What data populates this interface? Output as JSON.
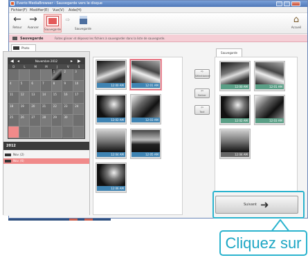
{
  "window": {
    "title": "Everio MediaBrowser - Sauvegarde vers le disque"
  },
  "menubar": [
    "Fichier(F)",
    "Modifier(E)",
    "Vue(V)",
    "Aide(H)"
  ],
  "toolbar": {
    "back_label": "Retour",
    "forward_label": "Avancer",
    "card_label": "Sauvegarde",
    "disk_label": "Sauvegarde",
    "home_label": "Accueil"
  },
  "strip": {
    "title": "Sauvegarde",
    "text": "Faites glisser et déposez les fichiers à sauvegarder dans la liste de sauvegarde."
  },
  "left_panel": {
    "tab_label": "Photo",
    "calendar": {
      "month": "Novembre 2012",
      "weekdays": [
        "D",
        "L",
        "M",
        "M",
        "J",
        "V",
        "S"
      ],
      "days": [
        "",
        "",
        "",
        "",
        "1",
        "2",
        "3",
        "4",
        "5",
        "6",
        "7",
        "8",
        "9",
        "10",
        "11",
        "12",
        "13",
        "14",
        "15",
        "16",
        "17",
        "18",
        "19",
        "20",
        "21",
        "22",
        "23",
        "24",
        "25",
        "26",
        "27",
        "28",
        "29",
        "30",
        "",
        "",
        "",
        "",
        "",
        "",
        "",
        ""
      ]
    },
    "year": "2012",
    "year_items": [
      "Nov. (2)",
      "Nov. (6)"
    ]
  },
  "media_grid": {
    "items": [
      {
        "caption": "12:00 AM"
      },
      {
        "caption": "12:01 AM"
      },
      {
        "caption": "12:02 AM"
      },
      {
        "caption": "12:03 AM"
      },
      {
        "caption": "12:04 AM"
      },
      {
        "caption": "12:05 AM"
      },
      {
        "caption": "12:06 AM"
      }
    ]
  },
  "actions": [
    {
      "glyph": "⇨",
      "label": "Sélectionner"
    },
    {
      "glyph": "⇦",
      "label": "Retirer"
    },
    {
      "glyph": "⇦",
      "label": "Tout"
    }
  ],
  "right_panel": {
    "tab_label": "Sauvegarde",
    "items": [
      {
        "caption": "12:00 AM"
      },
      {
        "caption": "12:01 AM"
      },
      {
        "caption": "12:02 AM"
      },
      {
        "caption": "12:03 AM"
      },
      {
        "caption": "12:04 AM"
      }
    ]
  },
  "save_button": {
    "label": "Suivant",
    "arrow": "➜"
  },
  "callout": {
    "text": "Cliquez sur"
  },
  "colors": {
    "accent_pink": "#f08a8a",
    "caption_blue": "#3f84b3",
    "callout_cyan": "#2ab3ce"
  }
}
